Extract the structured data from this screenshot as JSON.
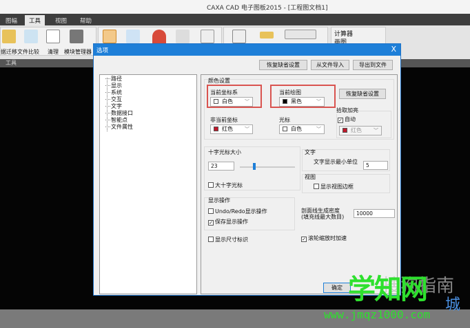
{
  "window": {
    "title": "CAXA CAD 电子图板2015 - [工程图文档1]"
  },
  "menu": {
    "tabs": [
      "图幅",
      "工具",
      "视图",
      "帮助"
    ],
    "active": "工具"
  },
  "ribbon": {
    "buttons": [
      "据迁移",
      "文件比较",
      "清理",
      "模块管理器"
    ],
    "side_items": [
      "计算器",
      "画图"
    ],
    "section_label": "工具"
  },
  "dialog": {
    "title": "选项",
    "close": "X",
    "top_buttons": [
      "恢复缺省设置",
      "从文件导入",
      "导出到文件"
    ],
    "tree": [
      "路径",
      "显示",
      "系统",
      "交互",
      "文字",
      "数据接口",
      "智能点",
      "文件属性"
    ],
    "color_settings": {
      "group": "颜色设置",
      "current_coord_label": "当前坐标系",
      "current_coord_value": "白色",
      "current_coord_color": "#ffffff",
      "current_draw_label": "当前绘图",
      "current_draw_value": "黑色",
      "current_draw_color": "#000000",
      "restore_button": "恢复缺省设置",
      "noncurrent_coord_label": "非当前坐标",
      "noncurrent_coord_value": "红色",
      "noncurrent_coord_color": "#c0182a",
      "cursor_label": "光标",
      "cursor_value": "白色",
      "cursor_color": "#ffffff",
      "highlight_group": "拾取加亮",
      "auto_label": "自动",
      "auto_checked": true,
      "highlight_value": "红色"
    },
    "crosshair": {
      "group": "十字光标大小",
      "size_value": "23",
      "slider_fraction": 0.3,
      "big_cross_label": "大十字光标",
      "big_cross_checked": false
    },
    "text": {
      "group": "文字",
      "min_unit_label": "文字显示最小单位",
      "min_unit_value": "5"
    },
    "view": {
      "group": "视图",
      "show_border_label": "显示视图边框",
      "show_border_checked": false
    },
    "display_ops": {
      "group": "显示操作",
      "undo_label": "Undo/Redo显示操作",
      "undo_checked": false,
      "save_label": "保存显示操作",
      "save_checked": true
    },
    "hatch": {
      "label1": "剖面线生成密度",
      "label2": "(填充线最大数目)",
      "value": "10000"
    },
    "show_dim_label": "显示尺寸标识",
    "show_dim_checked": false,
    "wheel_label": "滚轮缩放时加速",
    "wheel_checked": true,
    "ok_button": "确定"
  },
  "watermark": {
    "main": "学知网",
    "url": "www.jmqz1000.com",
    "sogou": "搜狗指南",
    "extra": "城"
  }
}
